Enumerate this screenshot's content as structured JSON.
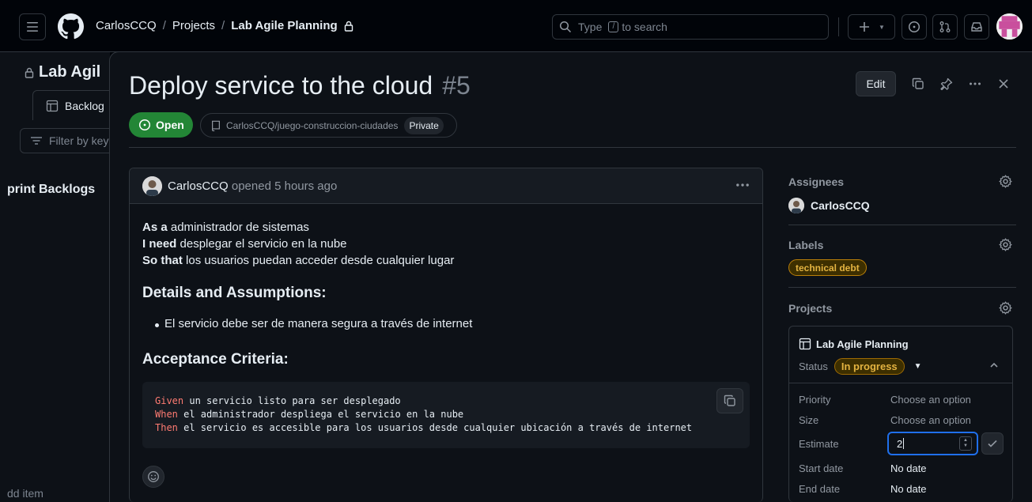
{
  "header": {
    "owner": "CarlosCCQ",
    "projects": "Projects",
    "project_name": "Lab Agile Planning",
    "search_placeholder_before": "Type",
    "search_key": "/",
    "search_placeholder_after": "to search"
  },
  "background": {
    "title": "Lab Agil",
    "tab": "Backlog",
    "filter": "Filter by key",
    "sprint": "print Backlogs",
    "add_item": "dd item"
  },
  "issue": {
    "title": "Deploy service to the cloud",
    "number": "#5",
    "edit": "Edit",
    "state": "Open",
    "repo": "CarlosCCQ/juego-construccion-ciudades",
    "visibility": "Private"
  },
  "comment": {
    "author": "CarlosCCQ",
    "opened": "opened",
    "time": "5 hours ago",
    "as_a_label": "As a",
    "as_a": "administrador de sistemas",
    "i_need_label": "I need",
    "i_need": "desplegar el servicio en la nube",
    "so_that_label": "So that",
    "so_that": "los usuarios puedan acceder desde cualquier lugar",
    "details_heading": "Details and Assumptions:",
    "details_item": "El servicio debe ser de manera segura a través de internet",
    "acceptance_heading": "Acceptance Criteria:",
    "code": [
      {
        "kw": "Given",
        "text": " un servicio listo para ser desplegado"
      },
      {
        "kw": "When",
        "text": " el administrador despliega el servicio en la nube"
      },
      {
        "kw": "Then",
        "text": " el servicio es accesible para los usuarios desde cualquier ubicación a través de internet"
      }
    ]
  },
  "sidebar": {
    "assignees_label": "Assignees",
    "assignee": "CarlosCCQ",
    "labels_label": "Labels",
    "label": "technical debt",
    "projects_label": "Projects",
    "project": {
      "name": "Lab Agile Planning",
      "status_label": "Status",
      "status": "In progress",
      "fields": [
        {
          "name": "Priority",
          "value": "Choose an option"
        },
        {
          "name": "Size",
          "value": "Choose an option"
        },
        {
          "name": "Estimate",
          "value": "2"
        },
        {
          "name": "Start date",
          "value": "No date"
        },
        {
          "name": "End date",
          "value": "No date"
        }
      ]
    }
  },
  "colors": {
    "accent_blue": "#1f6feb",
    "open_green": "#238636",
    "status_yellow": "#e3b341",
    "code_keyword": "#ff7b72"
  }
}
